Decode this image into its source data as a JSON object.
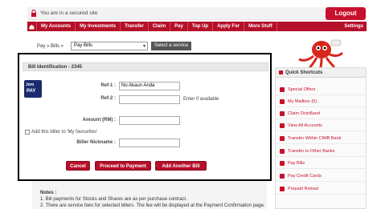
{
  "secure_bar": {
    "text": "You are in a secured site"
  },
  "header": {
    "logout_label": "Logout"
  },
  "nav": {
    "items": [
      "My Accounts",
      "My Investments",
      "Transfer",
      "Claim",
      "Pay",
      "Top Up",
      "Apply For",
      "More Stuff"
    ],
    "settings_label": "Settings"
  },
  "breadcrumb": {
    "path": "Pay » Bills »",
    "select_value": "Pay Bills",
    "select_service_label": "Select a service"
  },
  "modal": {
    "title": "Bill Identification - 2345",
    "logo_text_top": "Jom",
    "logo_text_bottom": "PAY",
    "ref1_label": "Ref-1 :",
    "ref1_value": "No Akaun Anda",
    "ref2_label": "Ref-2 :",
    "ref2_value": "",
    "ref2_hint": "Enter if available",
    "amount_label": "Amount (RM) :",
    "amount_value": "",
    "favourite_label": "Add this biller to 'My favourites'",
    "nickname_label": "Biller Nickname :",
    "nickname_value": "",
    "buttons": {
      "cancel": "Cancel",
      "proceed": "Proceed to Payment",
      "add_another": "Add Another Bill"
    }
  },
  "notes": {
    "title": "Notes :",
    "lines": [
      "1. Bill payments for Stocks and Shares are as per purchase contract.",
      "2. There are service fees for selected billers. The fee will be displayed at the Payment Confirmation page."
    ]
  },
  "quick_shortcuts": {
    "title": "Quick Shortcuts",
    "items": [
      "Special Offers",
      "My Mailbox (0)",
      "Claim OctoBand",
      "View All Accounts",
      "Transfer Within CIMB Bank",
      "Transfer to Other Banks",
      "Pay Bills",
      "Pay Credit Cards",
      "Prepaid Reload"
    ]
  },
  "colors": {
    "brand_red": "#b5102a",
    "accent_red": "#c8102e",
    "jompay_blue": "#1a2c6e"
  },
  "icons": {
    "lock": "lock-icon",
    "home": "home-icon",
    "mascot": "octopus-mascot",
    "shortcut": "shortcut-icon"
  }
}
